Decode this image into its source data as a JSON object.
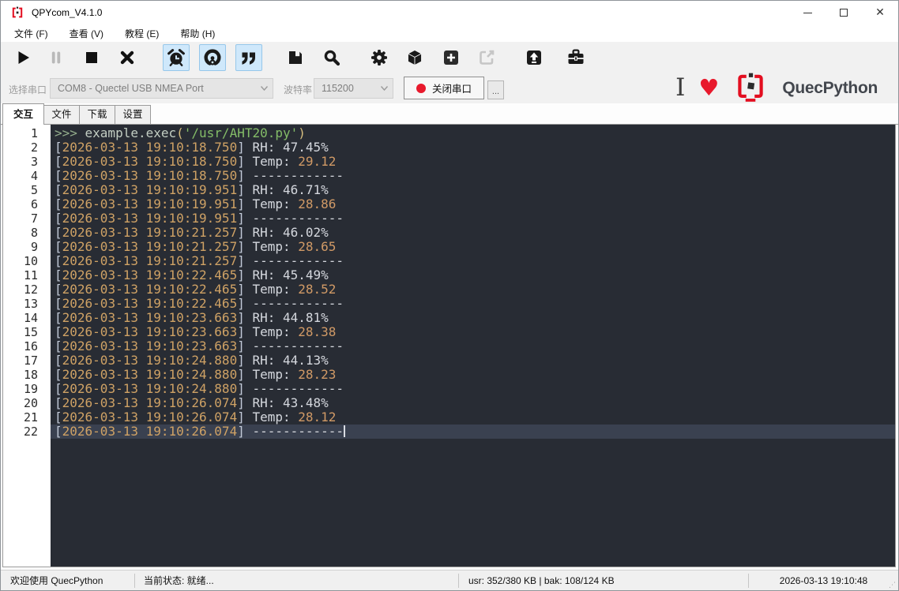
{
  "colors": {
    "toggle_bg": "#cfe8fb",
    "toggle_border": "#96c7ea",
    "terminal_bg": "#282c34",
    "current_line": "#3a4150",
    "timestamp": "#cfa265",
    "bracket": "#c2cad8",
    "text": "#d5d8de",
    "number": "#d19a66",
    "prompt": "#93ad8c",
    "code": "#c3cec3",
    "paren": "#d6bd7e",
    "string": "#84bd68",
    "red": "#e8192c",
    "brand_red": "#e30e20"
  },
  "window": {
    "title": "QPYcom_V4.1.0"
  },
  "menu_bar": {
    "items": [
      {
        "label": "文件 (F)"
      },
      {
        "label": "查看 (V)"
      },
      {
        "label": "教程 (E)"
      },
      {
        "label": "帮助 (H)"
      }
    ]
  },
  "toolbar": {
    "buttons": [
      {
        "id": "run",
        "icon": "play-icon",
        "state": "normal"
      },
      {
        "id": "pause",
        "icon": "pause-icon",
        "state": "disabled"
      },
      {
        "id": "stop",
        "icon": "stop-icon",
        "state": "normal"
      },
      {
        "id": "kill",
        "icon": "x-icon",
        "state": "normal"
      },
      {
        "id": "timestamp",
        "icon": "alarm-clock-icon",
        "state": "toggled"
      },
      {
        "id": "raw-mode",
        "icon": "person-circle-icon",
        "state": "toggled"
      },
      {
        "id": "quote-mode",
        "icon": "quotes-icon",
        "state": "toggled"
      },
      {
        "id": "save-log",
        "icon": "floppy-icon",
        "state": "normal"
      },
      {
        "id": "search",
        "icon": "magnifier-icon",
        "state": "normal"
      },
      {
        "id": "settings",
        "icon": "gear-icon",
        "state": "normal"
      },
      {
        "id": "firmware",
        "icon": "package-icon",
        "state": "normal"
      },
      {
        "id": "add",
        "icon": "plus-square-icon",
        "state": "normal"
      },
      {
        "id": "export",
        "icon": "share-icon",
        "state": "disabled"
      },
      {
        "id": "upload",
        "icon": "upload-icon",
        "state": "normal"
      },
      {
        "id": "toolbox",
        "icon": "toolbox-icon",
        "state": "normal"
      }
    ]
  },
  "port_bar": {
    "port_label": "选择串口",
    "port_value": "COM8 - Quectel USB NMEA Port",
    "baud_label": "波特率",
    "baud_value": "115200",
    "close_port_button": "关闭串口",
    "more_button": "...",
    "brand": {
      "i_text": "I",
      "heart": "♥",
      "brand_name": "QuecPython"
    }
  },
  "tab_bar": {
    "tabs": [
      {
        "label": "交互",
        "active": true
      },
      {
        "label": "文件",
        "active": false
      },
      {
        "label": "下载",
        "active": false
      },
      {
        "label": "设置",
        "active": false
      }
    ]
  },
  "terminal": {
    "lines": [
      {
        "num": 1,
        "segments": [
          {
            "t": ">>> ",
            "c": "prompt"
          },
          {
            "t": "example.exec",
            "c": "code"
          },
          {
            "t": "(",
            "c": "paren"
          },
          {
            "t": "'/usr/AHT20.py'",
            "c": "str"
          },
          {
            "t": ")",
            "c": "paren"
          }
        ]
      },
      {
        "num": 2,
        "segments": [
          {
            "t": "[",
            "c": "brk"
          },
          {
            "t": "2026-03-13 19:10:18.750",
            "c": "ts"
          },
          {
            "t": "] ",
            "c": "brk"
          },
          {
            "t": "RH: 47.45%",
            "c": "plain"
          }
        ]
      },
      {
        "num": 3,
        "segments": [
          {
            "t": "[",
            "c": "brk"
          },
          {
            "t": "2026-03-13 19:10:18.750",
            "c": "ts"
          },
          {
            "t": "] ",
            "c": "brk"
          },
          {
            "t": "Temp: ",
            "c": "plain"
          },
          {
            "t": "29.12",
            "c": "num"
          }
        ]
      },
      {
        "num": 4,
        "segments": [
          {
            "t": "[",
            "c": "brk"
          },
          {
            "t": "2026-03-13 19:10:18.750",
            "c": "ts"
          },
          {
            "t": "] ",
            "c": "brk"
          },
          {
            "t": "------------",
            "c": "plain"
          }
        ]
      },
      {
        "num": 5,
        "segments": [
          {
            "t": "[",
            "c": "brk"
          },
          {
            "t": "2026-03-13 19:10:19.951",
            "c": "ts"
          },
          {
            "t": "] ",
            "c": "brk"
          },
          {
            "t": "RH: 46.71%",
            "c": "plain"
          }
        ]
      },
      {
        "num": 6,
        "segments": [
          {
            "t": "[",
            "c": "brk"
          },
          {
            "t": "2026-03-13 19:10:19.951",
            "c": "ts"
          },
          {
            "t": "] ",
            "c": "brk"
          },
          {
            "t": "Temp: ",
            "c": "plain"
          },
          {
            "t": "28.86",
            "c": "num"
          }
        ]
      },
      {
        "num": 7,
        "segments": [
          {
            "t": "[",
            "c": "brk"
          },
          {
            "t": "2026-03-13 19:10:19.951",
            "c": "ts"
          },
          {
            "t": "] ",
            "c": "brk"
          },
          {
            "t": "------------",
            "c": "plain"
          }
        ]
      },
      {
        "num": 8,
        "segments": [
          {
            "t": "[",
            "c": "brk"
          },
          {
            "t": "2026-03-13 19:10:21.257",
            "c": "ts"
          },
          {
            "t": "] ",
            "c": "brk"
          },
          {
            "t": "RH: 46.02%",
            "c": "plain"
          }
        ]
      },
      {
        "num": 9,
        "segments": [
          {
            "t": "[",
            "c": "brk"
          },
          {
            "t": "2026-03-13 19:10:21.257",
            "c": "ts"
          },
          {
            "t": "] ",
            "c": "brk"
          },
          {
            "t": "Temp: ",
            "c": "plain"
          },
          {
            "t": "28.65",
            "c": "num"
          }
        ]
      },
      {
        "num": 10,
        "segments": [
          {
            "t": "[",
            "c": "brk"
          },
          {
            "t": "2026-03-13 19:10:21.257",
            "c": "ts"
          },
          {
            "t": "] ",
            "c": "brk"
          },
          {
            "t": "------------",
            "c": "plain"
          }
        ]
      },
      {
        "num": 11,
        "segments": [
          {
            "t": "[",
            "c": "brk"
          },
          {
            "t": "2026-03-13 19:10:22.465",
            "c": "ts"
          },
          {
            "t": "] ",
            "c": "brk"
          },
          {
            "t": "RH: 45.49%",
            "c": "plain"
          }
        ]
      },
      {
        "num": 12,
        "segments": [
          {
            "t": "[",
            "c": "brk"
          },
          {
            "t": "2026-03-13 19:10:22.465",
            "c": "ts"
          },
          {
            "t": "] ",
            "c": "brk"
          },
          {
            "t": "Temp: ",
            "c": "plain"
          },
          {
            "t": "28.52",
            "c": "num"
          }
        ]
      },
      {
        "num": 13,
        "segments": [
          {
            "t": "[",
            "c": "brk"
          },
          {
            "t": "2026-03-13 19:10:22.465",
            "c": "ts"
          },
          {
            "t": "] ",
            "c": "brk"
          },
          {
            "t": "------------",
            "c": "plain"
          }
        ]
      },
      {
        "num": 14,
        "segments": [
          {
            "t": "[",
            "c": "brk"
          },
          {
            "t": "2026-03-13 19:10:23.663",
            "c": "ts"
          },
          {
            "t": "] ",
            "c": "brk"
          },
          {
            "t": "RH: 44.81%",
            "c": "plain"
          }
        ]
      },
      {
        "num": 15,
        "segments": [
          {
            "t": "[",
            "c": "brk"
          },
          {
            "t": "2026-03-13 19:10:23.663",
            "c": "ts"
          },
          {
            "t": "] ",
            "c": "brk"
          },
          {
            "t": "Temp: ",
            "c": "plain"
          },
          {
            "t": "28.38",
            "c": "num"
          }
        ]
      },
      {
        "num": 16,
        "segments": [
          {
            "t": "[",
            "c": "brk"
          },
          {
            "t": "2026-03-13 19:10:23.663",
            "c": "ts"
          },
          {
            "t": "] ",
            "c": "brk"
          },
          {
            "t": "------------",
            "c": "plain"
          }
        ]
      },
      {
        "num": 17,
        "segments": [
          {
            "t": "[",
            "c": "brk"
          },
          {
            "t": "2026-03-13 19:10:24.880",
            "c": "ts"
          },
          {
            "t": "] ",
            "c": "brk"
          },
          {
            "t": "RH: 44.13%",
            "c": "plain"
          }
        ]
      },
      {
        "num": 18,
        "segments": [
          {
            "t": "[",
            "c": "brk"
          },
          {
            "t": "2026-03-13 19:10:24.880",
            "c": "ts"
          },
          {
            "t": "] ",
            "c": "brk"
          },
          {
            "t": "Temp: ",
            "c": "plain"
          },
          {
            "t": "28.23",
            "c": "num"
          }
        ]
      },
      {
        "num": 19,
        "segments": [
          {
            "t": "[",
            "c": "brk"
          },
          {
            "t": "2026-03-13 19:10:24.880",
            "c": "ts"
          },
          {
            "t": "] ",
            "c": "brk"
          },
          {
            "t": "------------",
            "c": "plain"
          }
        ]
      },
      {
        "num": 20,
        "segments": [
          {
            "t": "[",
            "c": "brk"
          },
          {
            "t": "2026-03-13 19:10:26.074",
            "c": "ts"
          },
          {
            "t": "] ",
            "c": "brk"
          },
          {
            "t": "RH: 43.48%",
            "c": "plain"
          }
        ]
      },
      {
        "num": 21,
        "segments": [
          {
            "t": "[",
            "c": "brk"
          },
          {
            "t": "2026-03-13 19:10:26.074",
            "c": "ts"
          },
          {
            "t": "] ",
            "c": "brk"
          },
          {
            "t": "Temp: ",
            "c": "plain"
          },
          {
            "t": "28.12",
            "c": "num"
          }
        ]
      },
      {
        "num": 22,
        "segments": [
          {
            "t": "[",
            "c": "brk"
          },
          {
            "t": "2026-03-13 19:10:26.074",
            "c": "ts"
          },
          {
            "t": "] ",
            "c": "brk"
          },
          {
            "t": "------------",
            "c": "plain"
          }
        ],
        "current": true,
        "cursor": true
      }
    ]
  },
  "status_bar": {
    "welcome": "欢迎使用 QuecPython",
    "state": "当前状态: 就绪...",
    "storage": "usr: 352/380 KB | bak: 108/124 KB",
    "datetime": "2026-03-13 19:10:48"
  }
}
